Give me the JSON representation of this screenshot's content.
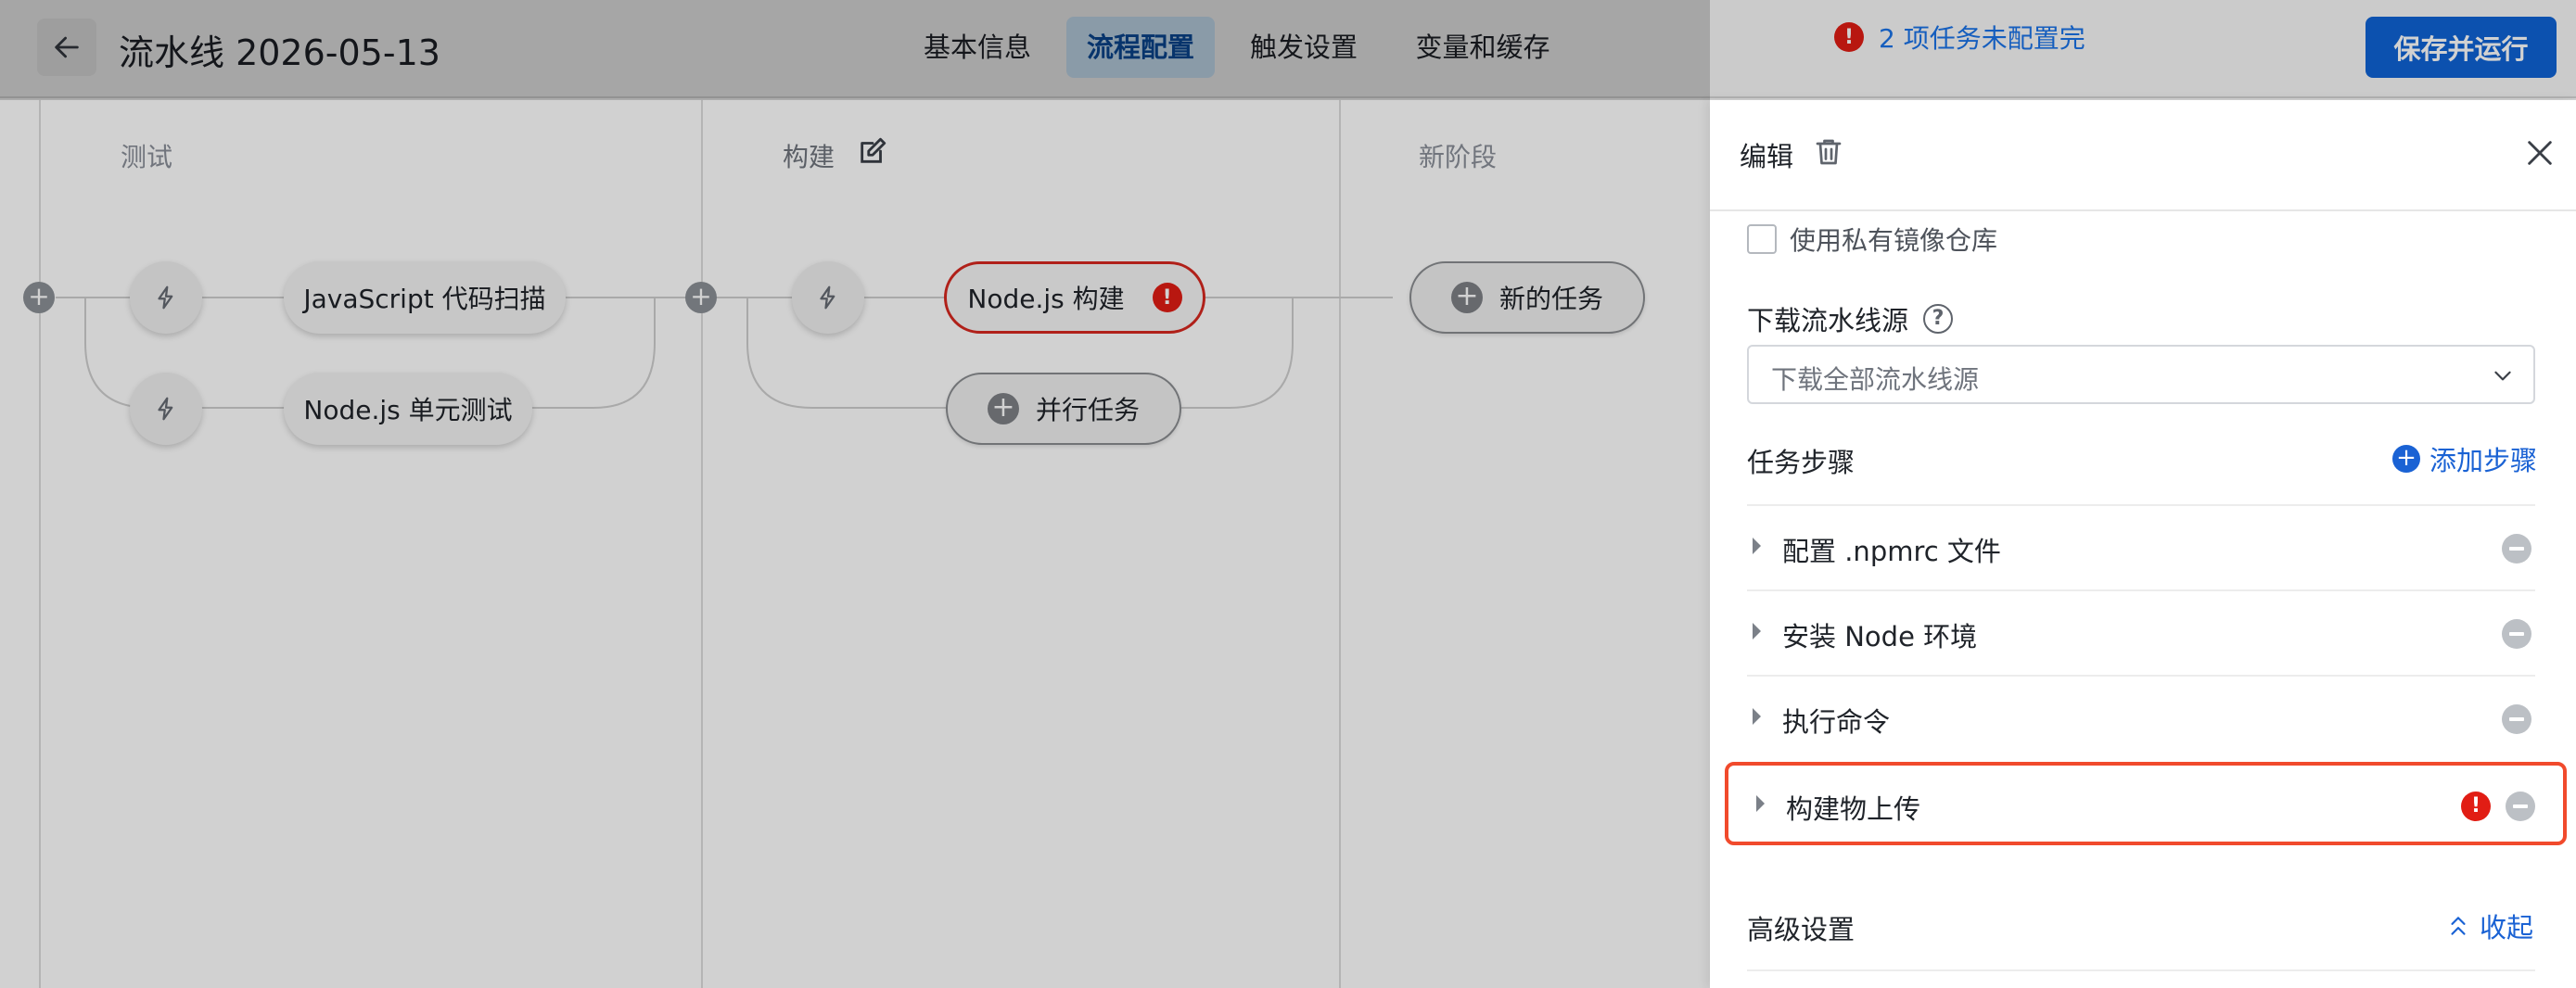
{
  "header": {
    "title": "流水线 2026-05-13",
    "tabs": [
      {
        "label": "基本信息",
        "active": false
      },
      {
        "label": "流程配置",
        "active": true
      },
      {
        "label": "触发设置",
        "active": false
      },
      {
        "label": "变量和缓存",
        "active": false
      }
    ],
    "warning_text": "2 项任务未配置完",
    "save_label": "保存并运行"
  },
  "stages": [
    {
      "title": "测试",
      "jobs": [
        "JavaScript 代码扫描",
        "Node.js 单元测试"
      ]
    },
    {
      "title": "构建",
      "jobs": [
        "Node.js 构建"
      ],
      "add_parallel_label": "并行任务"
    },
    {
      "title": "新阶段",
      "add_job_label": "新的任务"
    }
  ],
  "panel": {
    "title": "编辑",
    "private_registry_label": "使用私有镜像仓库",
    "source_label": "下载流水线源",
    "source_value": "下载全部流水线源",
    "steps_title": "任务步骤",
    "add_step_label": "添加步骤",
    "steps": [
      {
        "label": "配置 .npmrc 文件",
        "error": false
      },
      {
        "label": "安装 Node 环境",
        "error": false
      },
      {
        "label": "执行命令",
        "error": false
      },
      {
        "label": "构建物上传",
        "error": true
      }
    ],
    "advanced_title": "高级设置",
    "collapse_label": "收起"
  },
  "icons": {
    "error": "!",
    "help": "?",
    "plus": "+"
  },
  "colors": {
    "primary": "#0f63d6",
    "link": "#1a73e8",
    "error": "#e11d14",
    "highlight_border": "#f14a2c",
    "active_tab_bg": "#cfe7fb"
  }
}
